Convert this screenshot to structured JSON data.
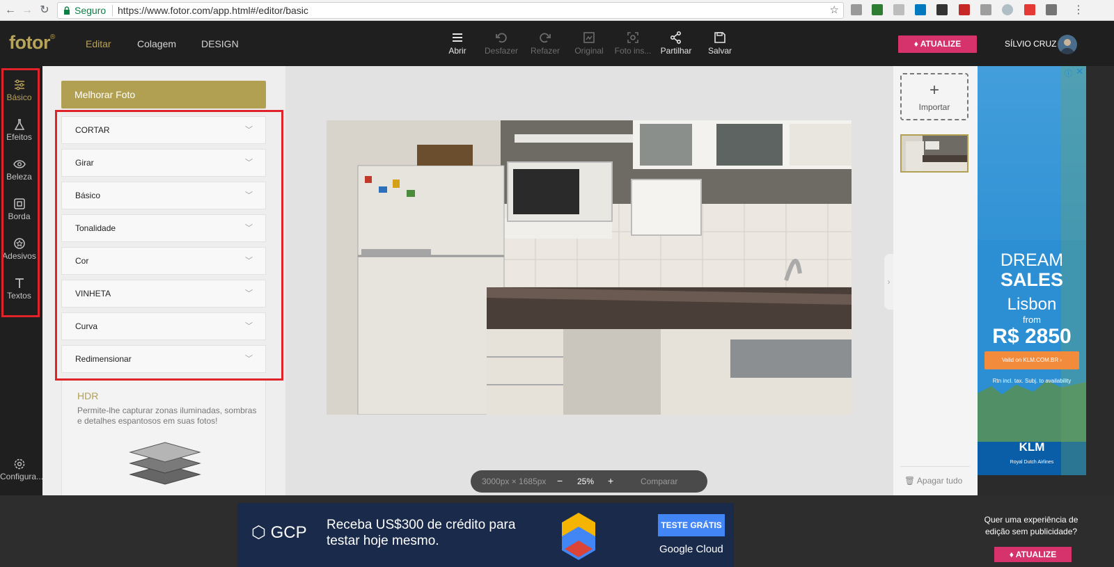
{
  "browser": {
    "secure_label": "Seguro",
    "url": "https://www.fotor.com/app.html#/editor/basic"
  },
  "header": {
    "logo": "fotor",
    "logo_mark": "®",
    "nav": [
      "Editar",
      "Colagem",
      "DESIGN"
    ],
    "tools": [
      {
        "label": "Abrir",
        "icon": "menu-icon",
        "enabled": true
      },
      {
        "label": "Desfazer",
        "icon": "undo-icon",
        "enabled": false
      },
      {
        "label": "Refazer",
        "icon": "redo-icon",
        "enabled": false
      },
      {
        "label": "Original",
        "icon": "original-icon",
        "enabled": false
      },
      {
        "label": "Foto ins...",
        "icon": "photo-inspect-icon",
        "enabled": false
      },
      {
        "label": "Partilhar",
        "icon": "share-icon",
        "enabled": true
      },
      {
        "label": "Salvar",
        "icon": "save-icon",
        "enabled": true
      }
    ],
    "upgrade_label": "ATUALIZE",
    "username": "SÍLVIO CRUZ"
  },
  "sidebar": {
    "items": [
      {
        "label": "Básico",
        "icon": "sliders-icon",
        "active": true
      },
      {
        "label": "Efeitos",
        "icon": "flask-icon",
        "active": false
      },
      {
        "label": "Beleza",
        "icon": "eye-icon",
        "active": false
      },
      {
        "label": "Borda",
        "icon": "frame-icon",
        "active": false
      },
      {
        "label": "Adesivos",
        "icon": "sticker-icon",
        "active": false
      },
      {
        "label": "Textos",
        "icon": "text-icon",
        "active": false
      }
    ],
    "settings_label": "Configura..."
  },
  "panel": {
    "enhance_label": "Melhorar Foto",
    "accordion": [
      "CORTAR",
      "Girar",
      "Básico",
      "Tonalidade",
      "Cor",
      "VINHETA",
      "Curva",
      "Redimensionar"
    ],
    "hdr_title": "HDR",
    "hdr_desc": "Permite-lhe capturar zonas iluminadas, sombras e detalhes espantosos em suas fotos!"
  },
  "canvas": {
    "dimensions": "3000px × 1685px",
    "zoom_out": "−",
    "zoom": "25%",
    "zoom_in": "+",
    "compare": "Comparar"
  },
  "right_panel": {
    "import_label": "Importar",
    "clear_label": "Apagar tudo"
  },
  "side_ad": {
    "dream": "DREAM",
    "sales": "SALES",
    "city": "Lisbon",
    "from": "from",
    "price": "R$ 2850",
    "button": "Valid on KLM.COM.BR  ›",
    "fine": "Rtn incl. tax. Subj. to availability",
    "brand": "KLM",
    "tagline": "Royal Dutch Airlines"
  },
  "bottom_ad": {
    "logo": "GCP",
    "text": "Receba US$300 de crédito para testar hoje mesmo.",
    "button": "TESTE GRÁTIS",
    "brand": "Google Cloud"
  },
  "no_ads": {
    "text": "Quer uma experiência de edição sem publicidade?",
    "button": "ATUALIZE"
  },
  "colors": {
    "accent_gold": "#b2a052",
    "upgrade_pink": "#d6336c",
    "highlight_red": "#e0232b",
    "header_dark": "#1f1f1f"
  }
}
